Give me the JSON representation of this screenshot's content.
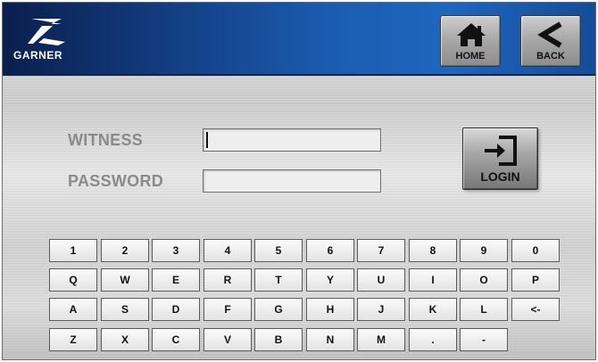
{
  "header": {
    "brand": "GARNER",
    "home_label": "HOME",
    "back_label": "BACK",
    "colors": {
      "gradient_start": "#0a1f4d",
      "gradient_end": "#1e66bf"
    }
  },
  "form": {
    "witness_label": "WITNESS",
    "witness_value": "",
    "password_label": "PASSWORD",
    "password_value": "",
    "login_label": "LOGIN"
  },
  "keyboard": {
    "rows": [
      [
        "1",
        "2",
        "3",
        "4",
        "5",
        "6",
        "7",
        "8",
        "9",
        "0"
      ],
      [
        "Q",
        "W",
        "E",
        "R",
        "T",
        "Y",
        "U",
        "I",
        "O",
        "P"
      ],
      [
        "A",
        "S",
        "D",
        "F",
        "G",
        "H",
        "J",
        "K",
        "L",
        "<-"
      ],
      [
        "Z",
        "X",
        "C",
        "V",
        "B",
        "N",
        "M",
        ".",
        "-"
      ]
    ]
  },
  "icons": {
    "home": "home-icon",
    "back": "chevron-left-icon",
    "login": "login-icon",
    "logo": "garner-logo"
  }
}
